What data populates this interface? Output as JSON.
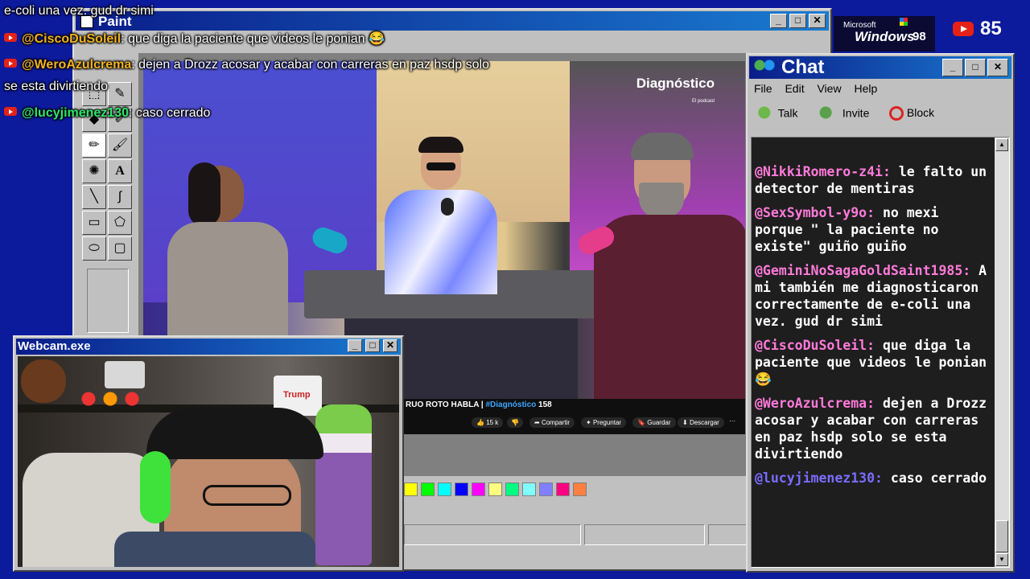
{
  "overlay": {
    "top_line": "e-coli una vez. gud dr simi",
    "messages": [
      {
        "user": "@CiscoDuSoleil",
        "text": ": que diga la paciente que videos le ponian 😂",
        "color": "#f2b21e"
      },
      {
        "user": "@WeroAzulcrema",
        "text": ": dejen a Drozz acosar y acabar con carreras en paz hsdp solo",
        "color": "#f2b21e",
        "wrap": "se esta divirtiendo"
      },
      {
        "user": "@lucyjimenez130",
        "text": ": caso cerrado",
        "color": "#2ee86b"
      }
    ],
    "subscriber_count": "85"
  },
  "windows98_logo": {
    "microsoft": "Microsoft",
    "windows": "Windows",
    "version": "98"
  },
  "paint": {
    "title": "Paint",
    "video_caption": "RUO ROTO HABLA | ",
    "video_hashtag": "#Diagnóstico",
    "video_number": "158",
    "channel_logo": "Diagnóstico",
    "channel_sub": "El podcast",
    "actions": {
      "likes": "15 k",
      "share": "Compartir",
      "ask": "Preguntar",
      "save": "Guardar",
      "download": "Descargar",
      "more": "···"
    },
    "palette": [
      "#ffff00",
      "#00ff00",
      "#00ffff",
      "#0000ff",
      "#ff00ff",
      "#ffff80",
      "#00ff80",
      "#80ffff",
      "#8080ff",
      "#ff0080",
      "#ff8040"
    ]
  },
  "webcam": {
    "title": "Webcam.exe",
    "poster_text": "Trump"
  },
  "chat": {
    "title": "Chat",
    "menu": [
      "File",
      "Edit",
      "View",
      "Help"
    ],
    "toolbar": {
      "talk": "Talk",
      "invite": "Invite",
      "block": "Block"
    },
    "messages": [
      {
        "user": "@NikkiRomero-z4i:",
        "text": " le falto un detector de mentiras",
        "color": "#ff7ad9"
      },
      {
        "user": "@SexSymbol-y9o:",
        "text": " no mexi porque \" la paciente no existe\" guiño guiño",
        "color": "#ff7ad9"
      },
      {
        "user": "@GeminiNoSagaGoldSaint1985:",
        "text": " A mi también me diagnosticaron correctamente de e-coli una vez. gud dr simi",
        "color": "#ff7ad9"
      },
      {
        "user": "@CiscoDuSoleil:",
        "text": " que diga la paciente que videos le ponian 😂",
        "color": "#ff7ad9"
      },
      {
        "user": "@WeroAzulcrema:",
        "text": " dejen a Drozz acosar y acabar con carreras en paz hsdp solo se esta divirtiendo",
        "color": "#ff7ad9"
      },
      {
        "user": "@lucyjimenez130:",
        "text": " caso cerrado",
        "color": "#7b6cff"
      }
    ]
  }
}
